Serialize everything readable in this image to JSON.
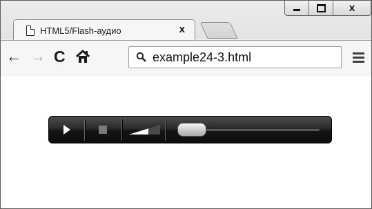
{
  "browser": {
    "tab": {
      "title": "HTML5/Flash-аудио",
      "close_glyph": "x",
      "icon": "page-icon"
    },
    "new_tab_icon": "new-tab-icon",
    "window_controls": {
      "minimize_icon": "minimize-icon",
      "maximize_icon": "maximize-icon",
      "close_glyph": "x"
    },
    "toolbar": {
      "back_glyph": "←",
      "forward_glyph": "→",
      "reload_glyph": "C",
      "home_icon": "home-icon",
      "url": "example24-3.html",
      "search_icon": "search-icon",
      "menu_icon": "hamburger-menu-icon"
    }
  },
  "player": {
    "play_icon": "play-icon",
    "stop_icon": "stop-icon",
    "volume_icon": "volume-level-icon",
    "progress": 0
  },
  "colors": {
    "player_bg": "#1a1a1a",
    "window_border": "#5a5a5a"
  }
}
